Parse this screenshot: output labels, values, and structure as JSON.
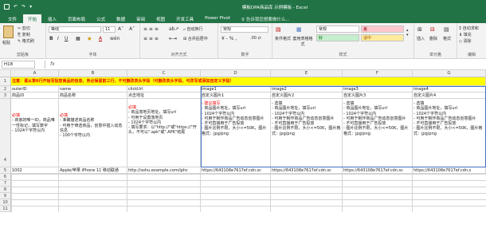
{
  "title_bar": {
    "title": "模板DPA商品库 示例模板 - Excel",
    "qa_icons": [
      "save-icon",
      "undo-icon",
      "redo-icon"
    ]
  },
  "tabs": [
    "文件",
    "开始",
    "插入",
    "页面布局",
    "公式",
    "数据",
    "审阅",
    "视图",
    "开发工具",
    "Power Pivot"
  ],
  "tell_me": "告诉我您想要做什么...",
  "ribbon": {
    "clipboard": {
      "cut": "剪切",
      "copy": "复制",
      "format_painter": "格式刷",
      "paste": "粘贴",
      "label": "剪贴板"
    },
    "font": {
      "name": "等线",
      "size": "11",
      "label": "字体"
    },
    "alignment": {
      "wrap": "自动换行",
      "merge": "合并后居中",
      "label": "对齐方式"
    },
    "number": {
      "format": "常规",
      "label": "数字"
    },
    "styles": {
      "conditional": "条件格式",
      "table": "套用表格格式",
      "label": "样式",
      "normal": "常规",
      "bad": "差",
      "good": "好",
      "neutral": "适中"
    },
    "cells": {
      "insert": "插入",
      "delete": "删除",
      "format": "格式",
      "label": "单元格"
    },
    "editing": {
      "autosum": "自动求和",
      "fill": "填充",
      "clear": "清除",
      "label": "编辑"
    }
  },
  "formula_bar": {
    "name_box": "H18",
    "fx": "fx",
    "formula": ""
  },
  "columns": [
    "A",
    "B",
    "C",
    "D",
    "E",
    "F",
    "G"
  ],
  "rows": {
    "r1": "注意：请从第6行开始写投放商品的信息，务必保留前三行，不可删改表头字段（可删改表头字段，可改写或添加自定义字段）",
    "r2": [
      "outerID",
      "name",
      "clickUrl",
      "image1",
      "image2",
      "image3",
      "image4"
    ],
    "r3": [
      "商品ID",
      "商品名称",
      "点击地址",
      "自定义图片1",
      "自定义图片2",
      "自定义图片3",
      "自定义图片4"
    ],
    "r4": {
      "a_req": "必填",
      "a_text": "- 商家的唯一ID，商品唯一性标记，填写数字\n- 1024个字符以内",
      "b_req": "必填",
      "b_text": "- 准确描述商品名称\n- 可用于筛选商品，创意中插入动态信息\n- 100个字符以内",
      "c_req": "必填",
      "c_text": "- 商品落地页地址，填写url\n- 可用于设置落地页\n- 1024个字符以内\n- 填写要求：以\"http://\"或\"https://\"开头，不可以\".apk\"或\".APK\"结尾",
      "d_req": "- 建议填写",
      "d_text": "- 商品图片地址，填写url\n- 1024个字符以内\n- 可用于制作商品广告动态创意图片\n- 不可直接用于广告投放\n- 图片比例不限，大小<=50K，图片格式：jpg/png",
      "e_text": "- 选填\n- 商品图片地址，填写url\n- 1024个字符以内\n- 可用于制作商品广告动态创意图片\n- 不可直接用于广告投放\n- 图片比例不限，大小<=50K，图片格式：jpg/png",
      "f_text": "- 选填\n- 商品图片地址，填写url\n- 1024个字符以内\n- 可用于制作商品广告动态创意图片\n- 不可直接用于广告投放\n- 图片比例不限，大小<=50K，图片格式：jpg/png",
      "g_text": "- 选填\n- 商品图片地址，填写url\n- 1024个字符以内\n- 可用于制作商品广告动态创意图片\n- 不可直接用于广告投放\n- 图片比例不限，大小<=50K，图片格式：jpg/png"
    },
    "r5": [
      "1002",
      "Apple/苹果 iPhone 11 移动联通",
      "http://sohu.example.com/iphc",
      "https://643108e7617ef.cdn.sc",
      "https://643108e7617ef.cdn.sc",
      "https://643108e7617ef.cdn.sc",
      "https://643108e7617ef.cdn.s"
    ]
  },
  "row_numbers": [
    "1",
    "2",
    "3",
    "4",
    "5",
    "6",
    "7",
    "8",
    "9",
    "10",
    "11"
  ]
}
